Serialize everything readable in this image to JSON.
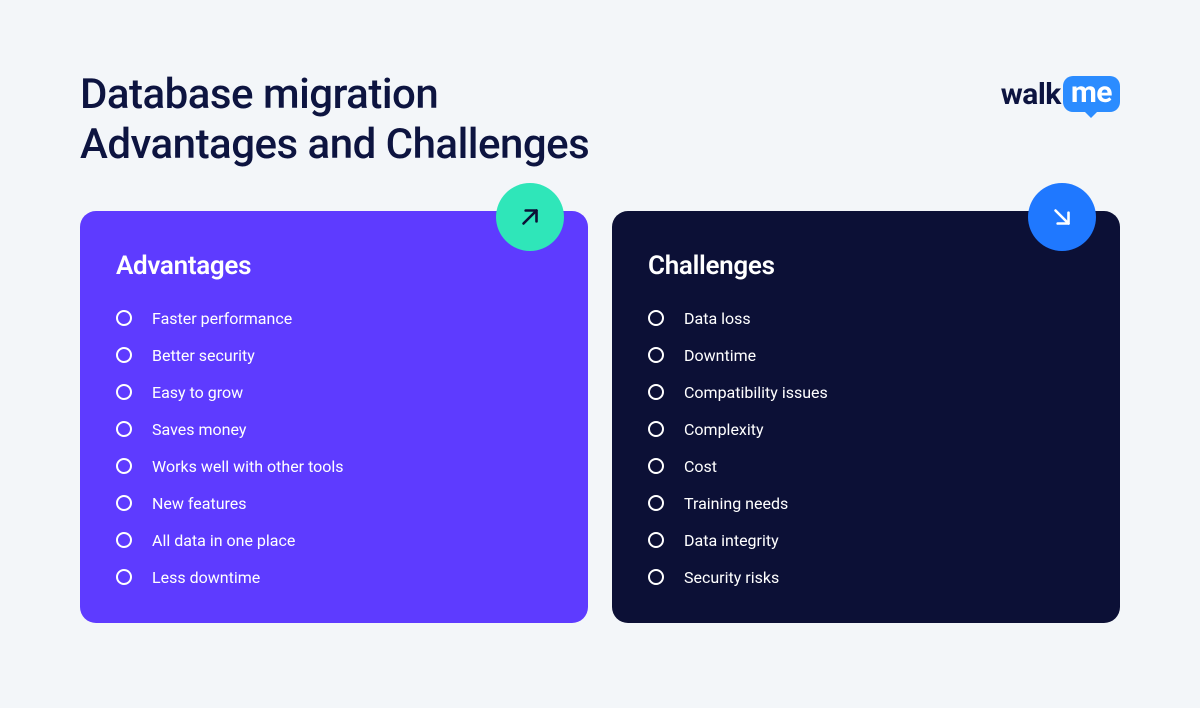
{
  "title_line1": "Database migration",
  "title_line2": "Advantages and Challenges",
  "logo": {
    "walk": "walk",
    "me": "me"
  },
  "cards": {
    "advantages": {
      "title": "Advantages",
      "items": [
        "Faster performance",
        "Better security",
        "Easy to grow",
        "Saves money",
        "Works well with other tools",
        "New features",
        "All data in one place",
        "Less downtime"
      ]
    },
    "challenges": {
      "title": "Challenges",
      "items": [
        "Data loss",
        "Downtime",
        "Compatibility issues",
        "Complexity",
        "Cost",
        "Training needs",
        "Data integrity",
        "Security risks"
      ]
    }
  },
  "colors": {
    "background": "#f3f6f9",
    "title_text": "#0d1440",
    "advantages_card": "#5e3bff",
    "challenges_card": "#0c1036",
    "badge_green": "#2fe6b9",
    "badge_blue": "#1f78ff",
    "logo_bubble": "#2b8cff"
  }
}
